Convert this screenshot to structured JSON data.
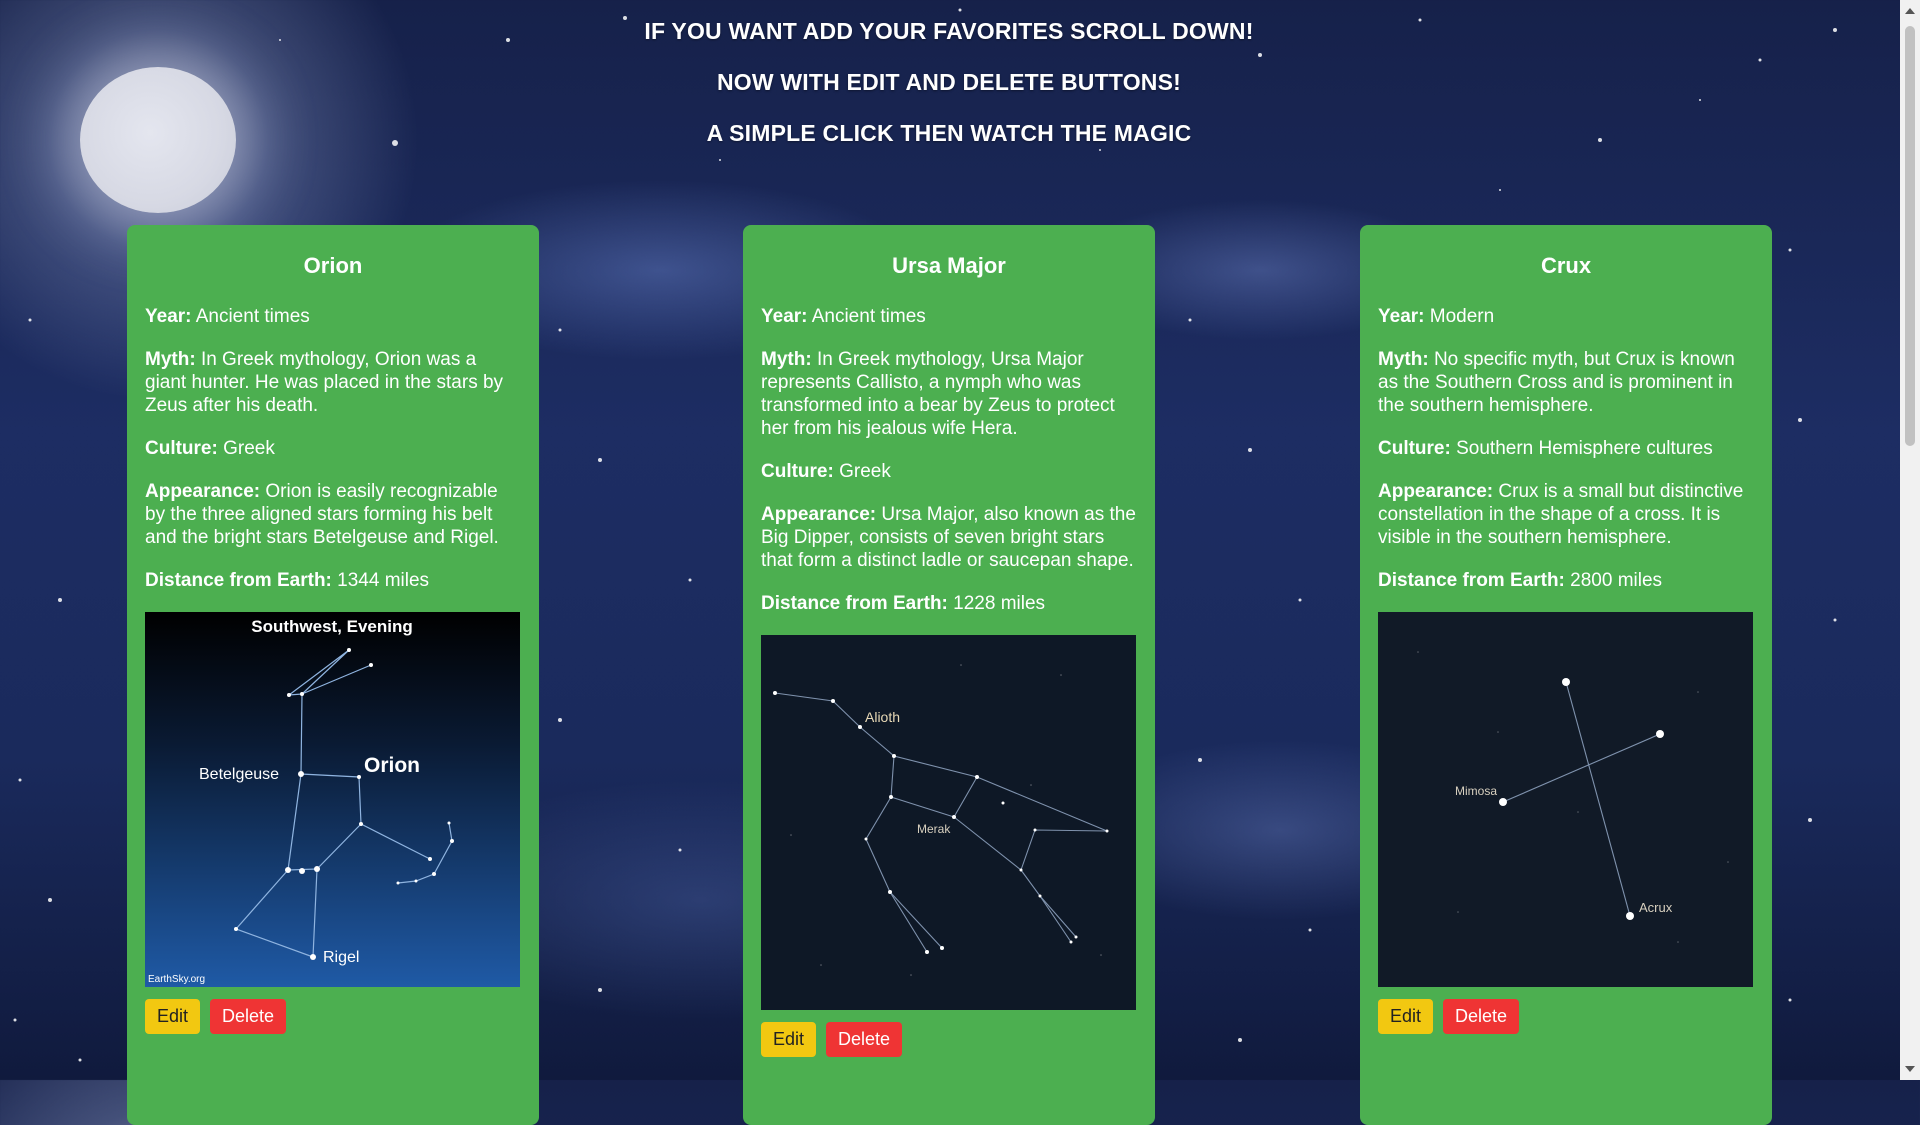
{
  "header": {
    "line1": "IF YOU WANT ADD YOUR FAVORITES SCROLL DOWN!",
    "line2": "NOW WITH EDIT AND DELETE BUTTONS!",
    "line3": "A SIMPLE CLICK THEN WATCH THE MAGIC"
  },
  "labels": {
    "year": "Year:",
    "myth": "Myth:",
    "culture": "Culture:",
    "appearance": "Appearance:",
    "distance": "Distance from Earth:"
  },
  "buttons": {
    "edit": "Edit",
    "delete": "Delete"
  },
  "colors": {
    "card": "#4caf50",
    "edit": "#f2c811",
    "delete": "#ef3434"
  },
  "cards": [
    {
      "name": "Orion",
      "year": "Ancient times",
      "myth": "In Greek mythology, Orion was a giant hunter. He was placed in the stars by Zeus after his death.",
      "culture": "Greek",
      "appearance": "Orion is easily recognizable by the three aligned stars forming his belt and the bright stars Betelgeuse and Rigel.",
      "distance": "1344 miles",
      "image": {
        "title": "Southwest, Evening",
        "constellation_label": "Orion",
        "star1": "Betelgeuse",
        "star2": "Rigel",
        "credit": "EarthSky.org"
      }
    },
    {
      "name": "Ursa Major",
      "year": "Ancient times",
      "myth": "In Greek mythology, Ursa Major represents Callisto, a nymph who was transformed into a bear by Zeus to protect her from his jealous wife Hera.",
      "culture": "Greek",
      "appearance": "Ursa Major, also known as the Big Dipper, consists of seven bright stars that form a distinct ladle or saucepan shape.",
      "distance": "1228 miles",
      "image": {
        "star1": "Alioth",
        "star2": "Merak"
      }
    },
    {
      "name": "Crux",
      "year": "Modern",
      "myth": "No specific myth, but Crux is known as the Southern Cross and is prominent in the southern hemisphere.",
      "culture": "Southern Hemisphere cultures",
      "appearance": "Crux is a small but distinctive constellation in the shape of a cross. It is visible in the southern hemisphere.",
      "distance": "2800 miles",
      "image": {
        "star1": "Mimosa",
        "star2": "Acrux"
      }
    }
  ]
}
